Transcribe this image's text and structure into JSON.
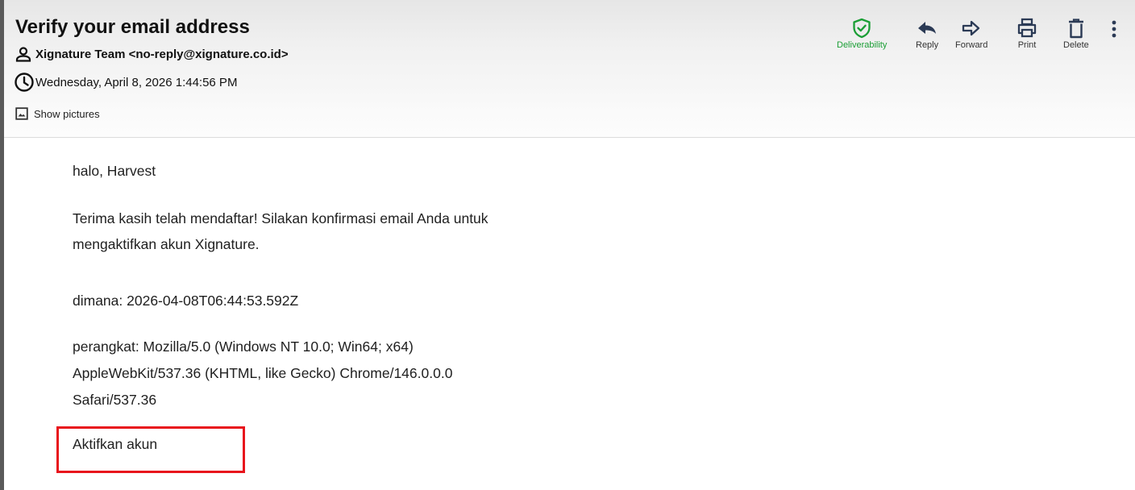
{
  "email": {
    "subject": "Verify your email address",
    "from": "Xignature Team <no-reply@xignature.co.id>",
    "date": "Wednesday, April 8, 2026 1:44:56 PM",
    "show_pictures": "Show pictures"
  },
  "toolbar": {
    "deliverability": "Deliverability",
    "reply": "Reply",
    "forward": "Forward",
    "print": "Print",
    "delete": "Delete"
  },
  "body": {
    "greeting": "halo, Harvest",
    "line1": "Terima kasih telah mendaftar! Silakan konfirmasi email Anda untuk",
    "line2": "mengaktifkan akun Xignature.",
    "where": "dimana: 2026-04-08T06:44:53.592Z",
    "device1": "perangkat: Mozilla/5.0 (Windows NT 10.0; Win64; x64)",
    "device2": "AppleWebKit/537.36 (KHTML, like Gecko) Chrome/146.0.0.0",
    "device3": "Safari/537.36",
    "activate": "Aktifkan akun"
  },
  "colors": {
    "deliverability_green": "#1a9e35",
    "highlight_red": "#e8141c"
  },
  "icons": [
    "person-icon",
    "clock-icon",
    "image-icon",
    "shield-check-icon",
    "reply-icon",
    "forward-icon",
    "print-icon",
    "trash-icon",
    "more-vert-icon"
  ]
}
